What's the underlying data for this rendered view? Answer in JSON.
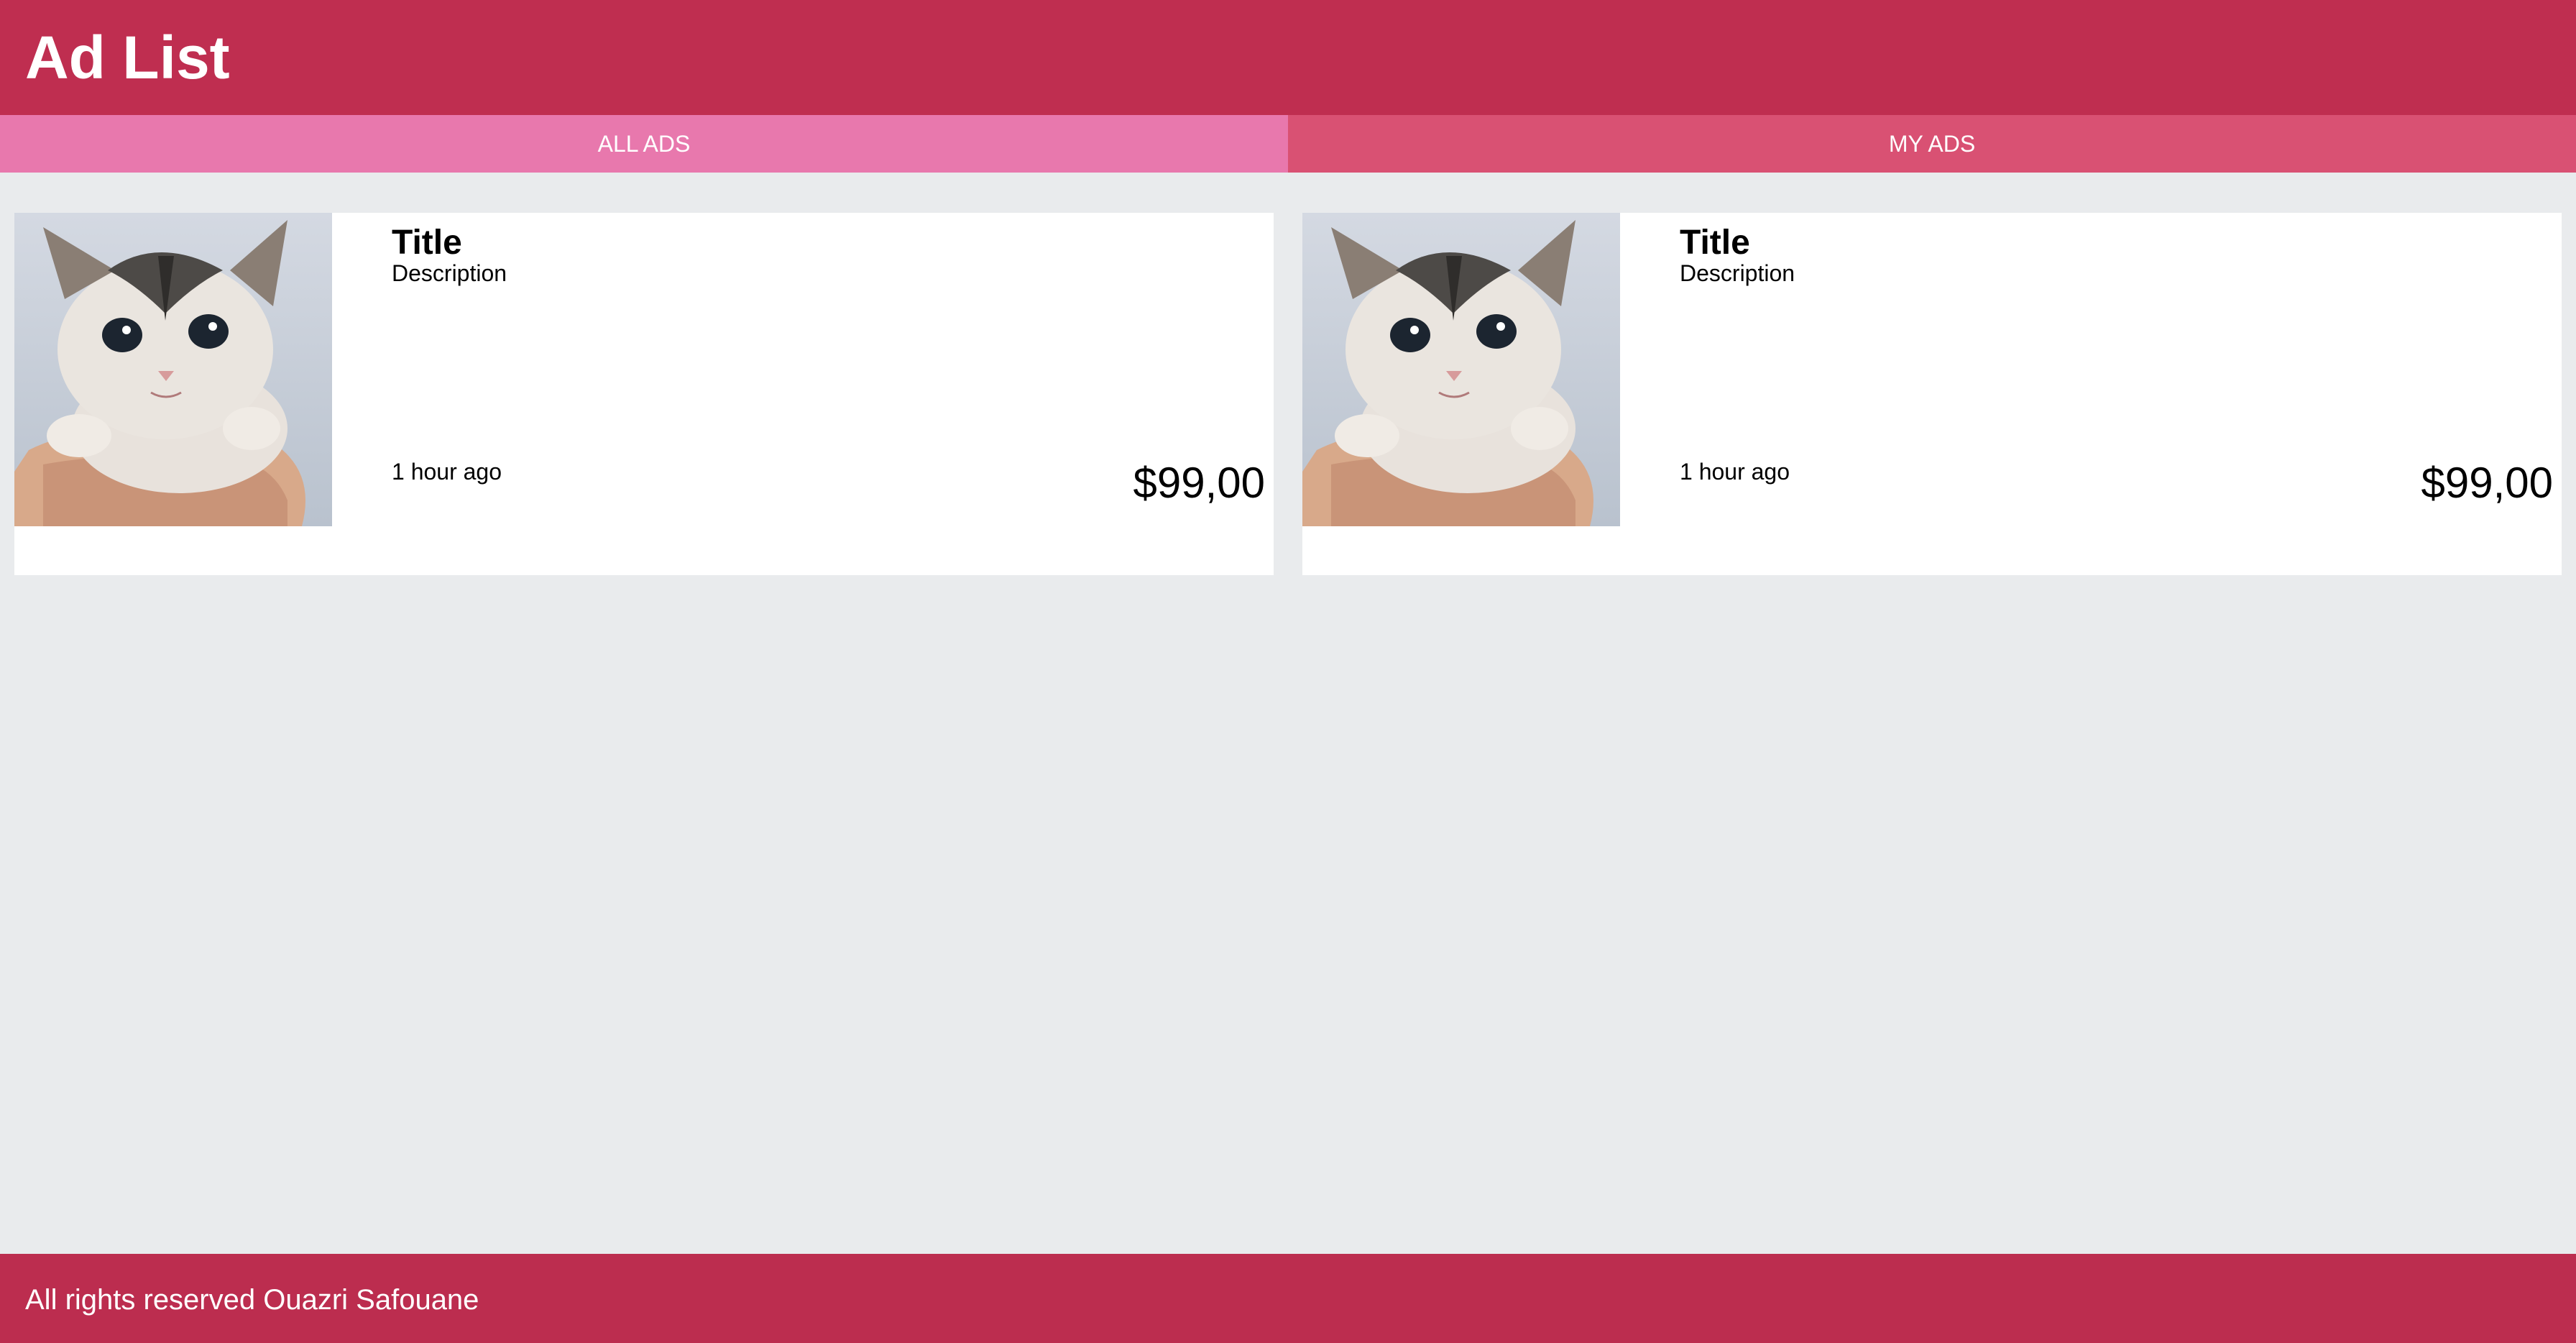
{
  "header": {
    "title": "Ad List"
  },
  "tabs": [
    {
      "label": "ALL ADS",
      "active": true
    },
    {
      "label": "MY ADS",
      "active": false
    }
  ],
  "ads": [
    {
      "image": "kitten-photo",
      "title": "Title",
      "description": "Description",
      "time": "1 hour ago",
      "price": "$99,00"
    },
    {
      "image": "kitten-photo",
      "title": "Title",
      "description": "Description",
      "time": "1 hour ago",
      "price": "$99,00"
    }
  ],
  "footer": {
    "text": "All rights reserved Ouazri Safouane"
  },
  "colors": {
    "header": "#bf2e50",
    "tab_active": "#e878ad",
    "tab_inactive": "#d95173",
    "background": "#e9ebed",
    "footer": "#bc2d4f"
  }
}
